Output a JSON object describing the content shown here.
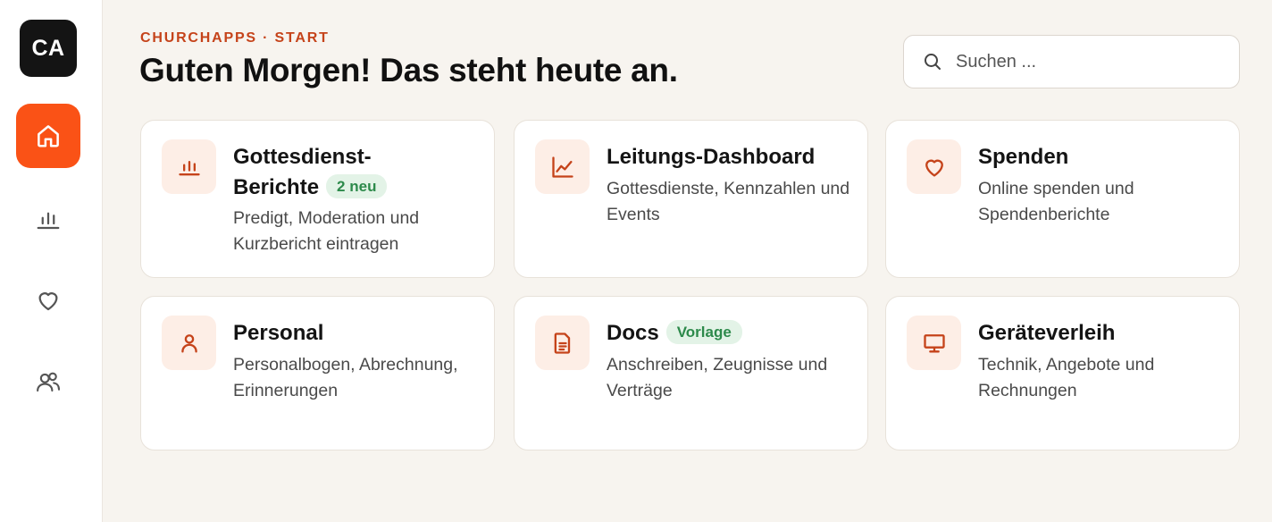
{
  "sidebar": {
    "logo": "CA",
    "items": [
      {
        "name": "home",
        "icon": "home-icon",
        "active": true
      },
      {
        "name": "reports",
        "icon": "bar-chart-icon",
        "active": false
      },
      {
        "name": "donations",
        "icon": "heart-icon",
        "active": false
      },
      {
        "name": "personnel",
        "icon": "users-icon",
        "active": false
      }
    ]
  },
  "header": {
    "eyebrow": "CHURCHAPPS · START",
    "title": "Guten Morgen! Das steht heute an."
  },
  "search": {
    "placeholder": "Suchen ..."
  },
  "cards": [
    {
      "title": "Gottesdienst-Berichte",
      "badge": "2 neu",
      "description": "Predigt, Moderation und Kurzbericht eintragen",
      "icon": "bar-chart-icon"
    },
    {
      "title": "Leitungs-Dashboard",
      "description": "Gottesdienste, Kennzahlen und Events",
      "icon": "line-chart-icon"
    },
    {
      "title": "Spenden",
      "description": "Online spenden und Spendenberichte",
      "icon": "heart-icon"
    },
    {
      "title": "Personal",
      "description": "Personalbogen, Abrechnung, Erinnerungen",
      "icon": "user-icon"
    },
    {
      "title": "Docs",
      "badge": "Vorlage",
      "description": "Anschreiben, Zeugnisse und Verträge",
      "icon": "document-icon"
    },
    {
      "title": "Geräteverleih",
      "description": "Technik, Angebote und Rechnungen",
      "icon": "monitor-icon"
    }
  ],
  "colors": {
    "accent": "#fa5216",
    "eyebrow": "#c5431a",
    "icon_stroke": "#c5431a",
    "icon_bg": "#fdeee6",
    "badge_bg": "#e3f3e7",
    "badge_text": "#2d8a4b",
    "background": "#f7f4ef"
  }
}
